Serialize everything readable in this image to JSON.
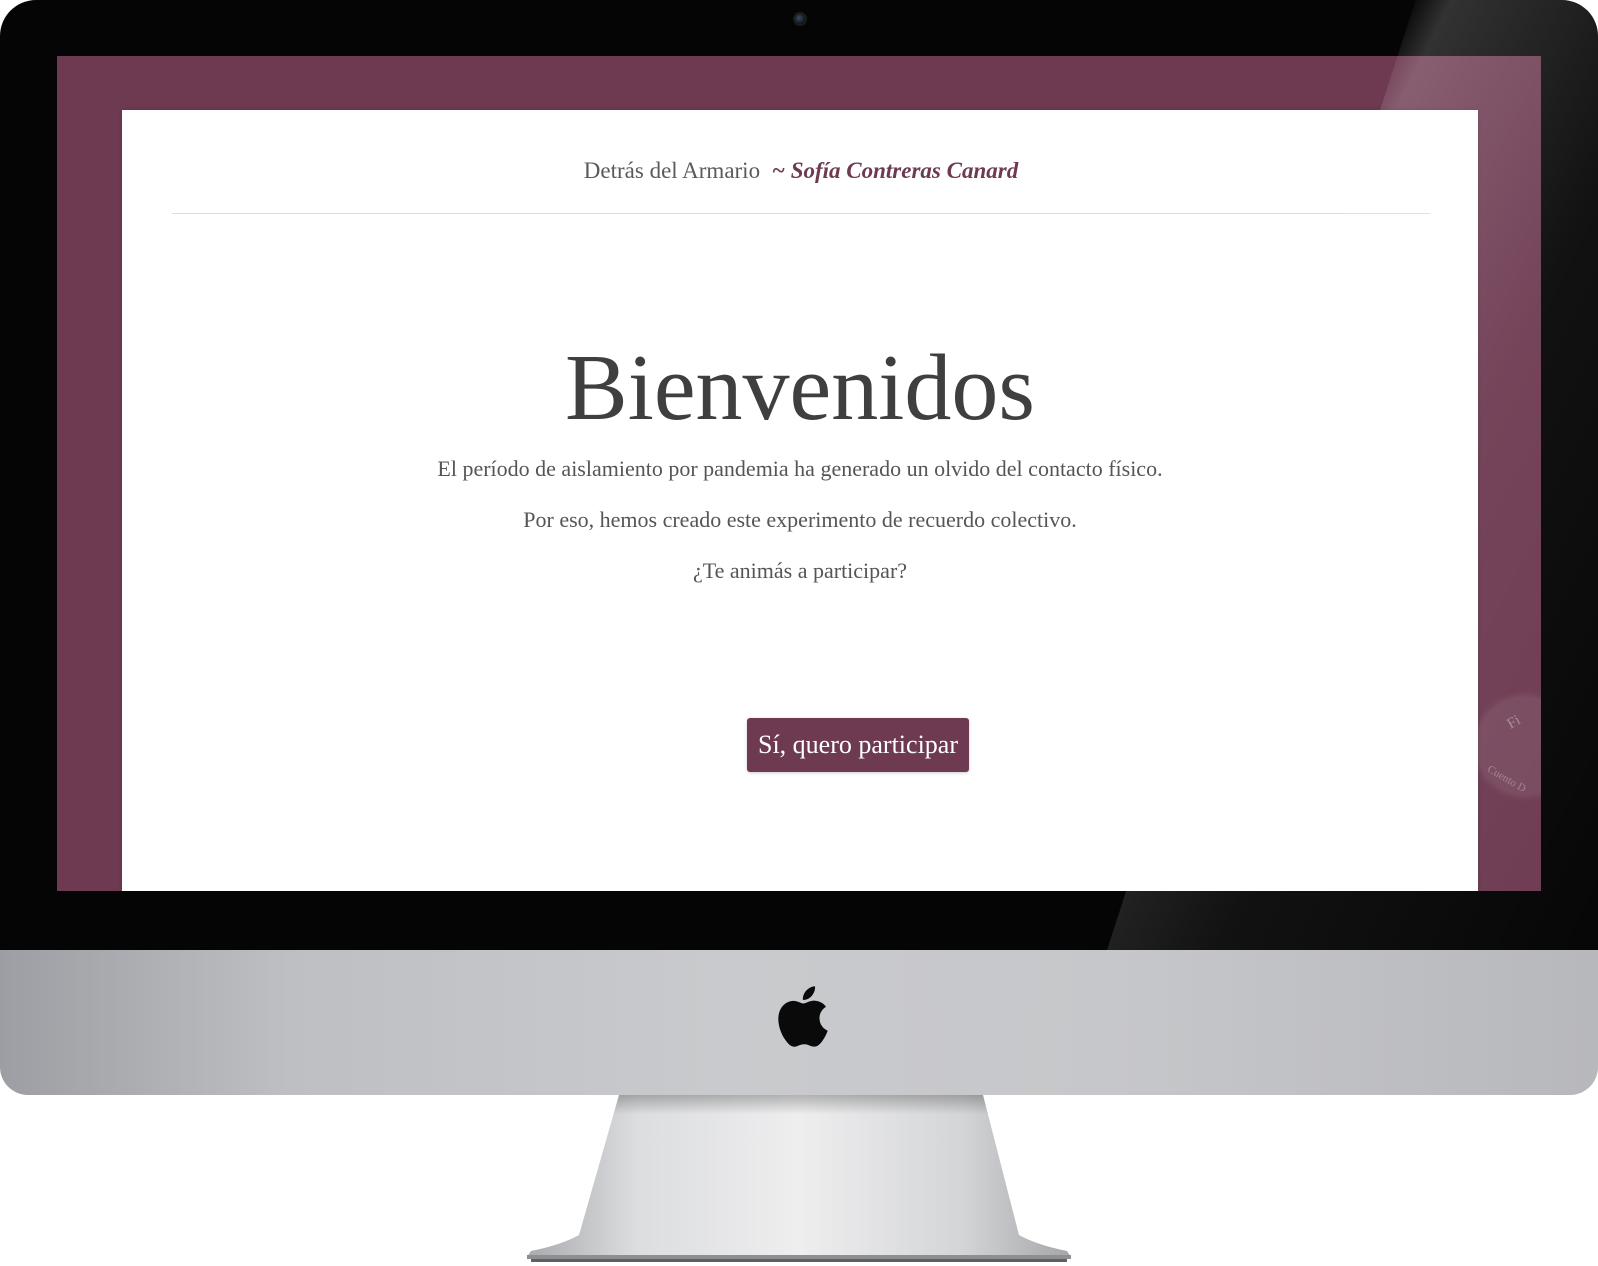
{
  "site": {
    "title": "Detrás del Armario",
    "separator": "~",
    "author": "Sofía Contreras Canard"
  },
  "hero": {
    "heading": "Bienvenidos",
    "lines": [
      "El período de aislamiento por pandemia ha generado un olvido del contacto físico.",
      "Por eso, hemos creado este experimento de recuerdo colectivo.",
      "¿Te animás a participar?"
    ],
    "cta_label": "Sí, quero participar"
  },
  "floating_badge": {
    "top_text": "Fi",
    "bottom_text": "Cuento D"
  },
  "colors": {
    "brand": "#6d3a51",
    "text": "#555555",
    "heading": "#3f3f3f",
    "bezel": "#050505",
    "aluminum": "#c6c7ca"
  },
  "icons": {
    "device_logo": "apple-logo-icon",
    "camera": "camera-icon"
  }
}
